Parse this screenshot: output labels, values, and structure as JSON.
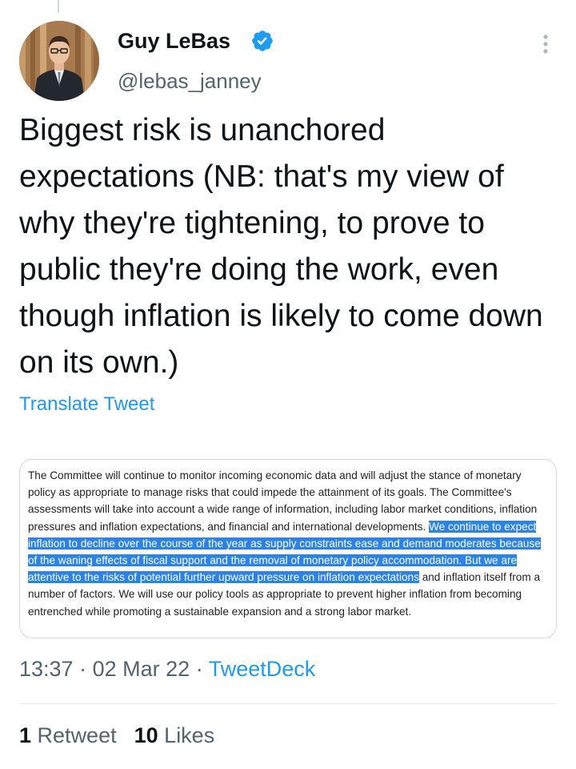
{
  "tweet": {
    "author": {
      "name": "Guy LeBas",
      "handle": "@lebas_janney",
      "verified": true
    },
    "text": "Biggest risk is unanchored expectations (NB: that's my view of why they're tightening, to prove to public they're doing the work, even though inflation is likely to come down on its own.)",
    "translate_label": "Translate Tweet",
    "attached_image": {
      "text_before": "The Committee will continue to monitor incoming economic data and will adjust the stance of monetary policy as appropriate to manage risks that could impede the attainment of its goals. The Committee's assessments will take into account a wide range of information, including labor market conditions, inflation pressures and inflation expectations, and financial and international developments.",
      "text_highlighted": "We continue to expect inflation to decline over the course of the year as supply constraints ease and demand moderates because of the waning effects of fiscal support and the removal of monetary policy accommodation. But we are attentive to the risks of potential further upward pressure on inflation expectations",
      "text_after": "and inflation itself from a number of factors. We will use our policy tools as appropriate to prevent higher inflation from becoming entrenched while promoting a sustainable expansion and a strong labor market."
    },
    "meta": {
      "time": "13:37",
      "separator": "·",
      "date": "02 Mar 22",
      "source": "TweetDeck"
    },
    "stats": {
      "retweets_count": "1",
      "retweets_label": "Retweet",
      "likes_count": "10",
      "likes_label": "Likes"
    }
  },
  "colors": {
    "accent": "#1d9bf0",
    "text_primary": "#0f1419",
    "text_secondary": "#536471",
    "highlight": "#2c83e6",
    "border": "#cfd9de"
  },
  "icons": {
    "verified": "verified-badge-icon",
    "more": "more-options-icon"
  }
}
